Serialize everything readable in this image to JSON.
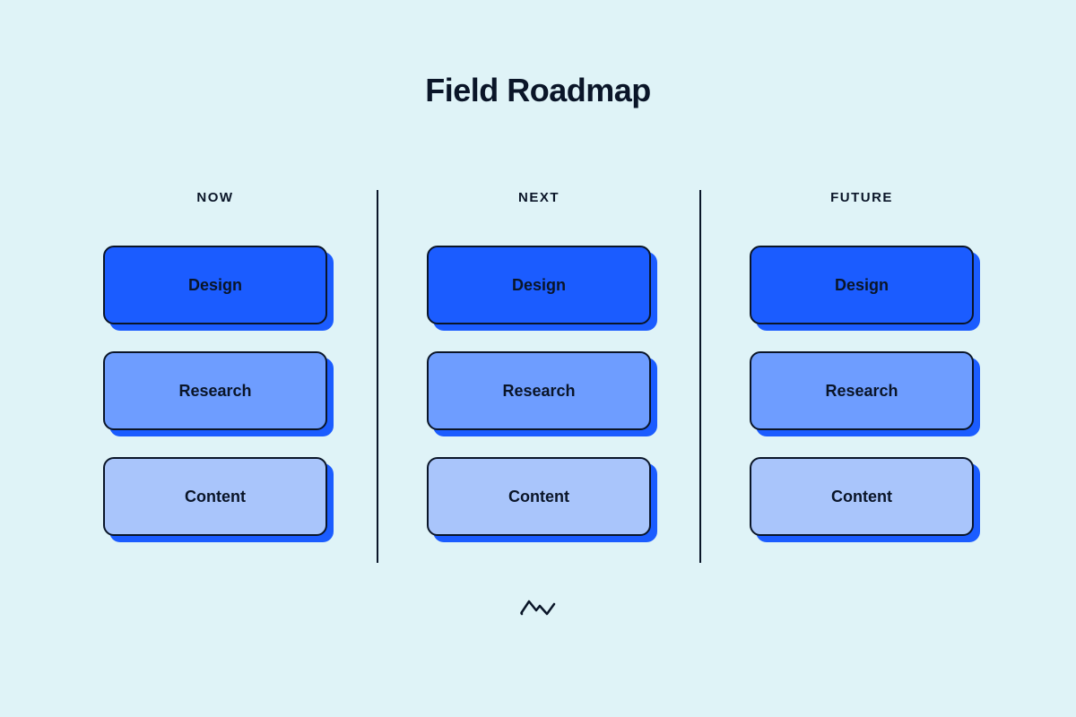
{
  "title": "Field Roadmap",
  "columns": [
    {
      "header": "NOW",
      "cards": [
        {
          "label": "Design",
          "tone": "design"
        },
        {
          "label": "Research",
          "tone": "research"
        },
        {
          "label": "Content",
          "tone": "content"
        }
      ]
    },
    {
      "header": "NEXT",
      "cards": [
        {
          "label": "Design",
          "tone": "design"
        },
        {
          "label": "Research",
          "tone": "research"
        },
        {
          "label": "Content",
          "tone": "content"
        }
      ]
    },
    {
      "header": "FUTURE",
      "cards": [
        {
          "label": "Design",
          "tone": "design"
        },
        {
          "label": "Research",
          "tone": "research"
        },
        {
          "label": "Content",
          "tone": "content"
        }
      ]
    }
  ]
}
